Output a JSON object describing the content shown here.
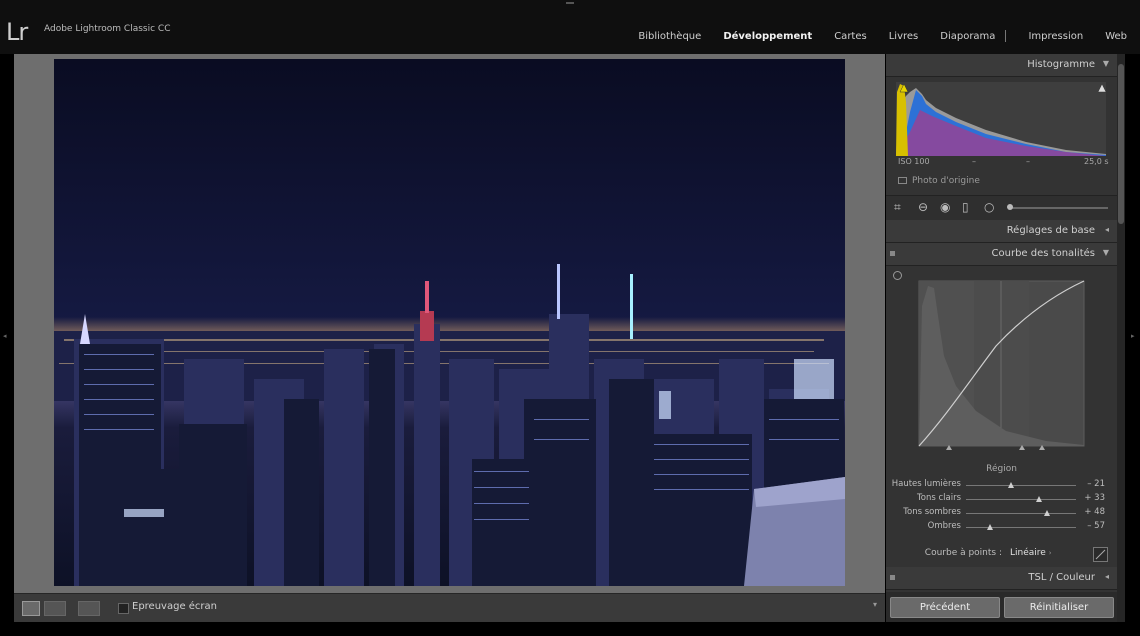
{
  "app": {
    "logo": "Lr",
    "name": "Adobe Lightroom Classic CC"
  },
  "modules": [
    {
      "label": "Bibliothèque",
      "active": false
    },
    {
      "label": "Développement",
      "active": true
    },
    {
      "label": "Cartes",
      "active": false
    },
    {
      "label": "Livres",
      "active": false
    },
    {
      "label": "Diaporama",
      "active": false
    },
    {
      "label": "Impression",
      "active": false
    },
    {
      "label": "Web",
      "active": false
    }
  ],
  "toolbar": {
    "soft_proofing_label": "Epreuvage écran",
    "soft_proofing_checked": false
  },
  "histogram": {
    "title": "Histogramme",
    "iso": "ISO 100",
    "focal": "–",
    "aperture": "–",
    "shutter": "25,0 s",
    "original_photo_label": "Photo d'origine"
  },
  "panels": {
    "basic_title": "Réglages de base",
    "tone_curve_title": "Courbe des tonalités",
    "hsl_title": "TSL / Couleur"
  },
  "tone_curve": {
    "region_title": "Région",
    "sliders": [
      {
        "label": "Hautes lumières",
        "value": "– 21",
        "level": -21
      },
      {
        "label": "Tons clairs",
        "value": "+ 33",
        "level": 33
      },
      {
        "label": "Tons sombres",
        "value": "+ 48",
        "level": 48
      },
      {
        "label": "Ombres",
        "value": "– 57",
        "level": -57
      }
    ],
    "point_curve_label": "Courbe à points :",
    "point_curve_value": "Linéaire"
  },
  "buttons": {
    "previous": "Précédent",
    "reset": "Réinitialiser"
  },
  "colors": {
    "accent_text": "#f2f2f2",
    "panel_bg": "#333333",
    "viewer_bg": "#6e6e6e"
  }
}
